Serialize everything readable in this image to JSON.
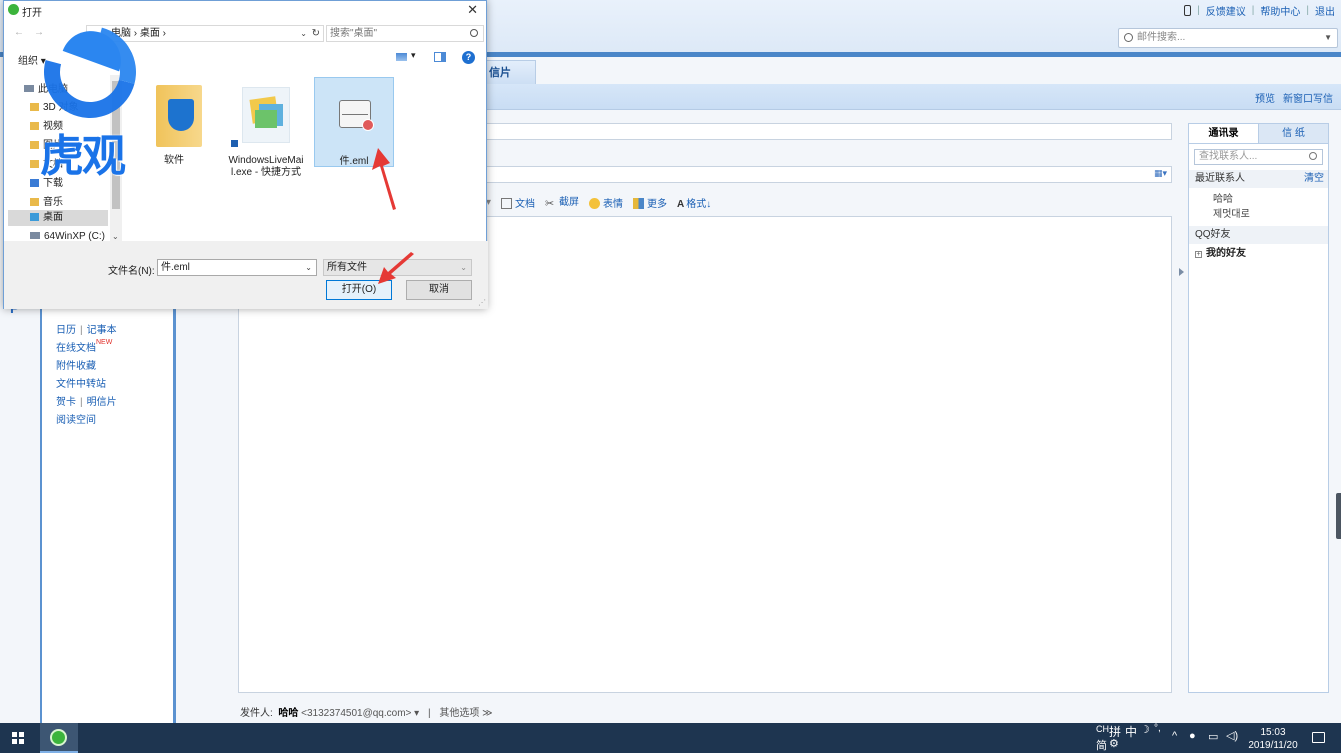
{
  "app": {
    "header_links": [
      "反馈建议",
      "帮助中心",
      "退出"
    ],
    "search_placeholder": "邮件搜索..."
  },
  "tab": {
    "label": "信片"
  },
  "toolbar": {
    "preview": "预览",
    "new_window": "新窗口写信"
  },
  "format_bar": [
    "文档",
    "截屏",
    "表情",
    "更多",
    "格式↓"
  ],
  "left_nav": {
    "calendar": "日历",
    "notes": "记事本",
    "online_docs": "在线文档",
    "new_badge": "NEW",
    "attachments": "附件收藏",
    "file_transfer": "文件中转站",
    "greeting_card": "贺卡",
    "postcard": "明信片",
    "reading": "阅读空间"
  },
  "sender": {
    "label": "发件人:",
    "name": "哈哈",
    "email": "<3132374501@qq.com>",
    "other": "其他选项"
  },
  "contacts": {
    "tab_address_book": "通讯录",
    "tab_stationery": "信 纸",
    "search_placeholder": "查找联系人...",
    "recent_label": "最近联系人",
    "clear": "清空",
    "recent": [
      "哈哈",
      "제멋대로"
    ],
    "qq_friends": "QQ好友",
    "my_friends": "我的好友"
  },
  "dialog": {
    "title": "打开",
    "breadcrumb": "电脑 › 桌面 ›",
    "search_placeholder": "搜索\"桌面\"",
    "organize": "组织 ▾",
    "tree": [
      "此电脑",
      "3D 对象",
      "视频",
      "图片",
      "文档",
      "下载",
      "音乐",
      "桌面",
      "64WinXP  (C:)"
    ],
    "files": [
      {
        "name": "软件"
      },
      {
        "name": "WindowsLiveMail.exe - 快捷方式"
      },
      {
        "name": "件.eml"
      }
    ],
    "filename_label": "文件名(N):",
    "filename_value": "件.eml",
    "filetype": "所有文件",
    "open_button": "打开(O)",
    "cancel_button": "取消"
  },
  "watermark": {
    "text": "虎观"
  },
  "taskbar": {
    "ime_lang": "CH",
    "ime_mode": "中",
    "ime_simplified": "简",
    "time": "15:03",
    "date": "2019/11/20"
  },
  "colors": {
    "accent": "#4a86c8",
    "link": "#1a5fb4",
    "arrow": "#e53935",
    "taskbar": "#1e3550"
  }
}
